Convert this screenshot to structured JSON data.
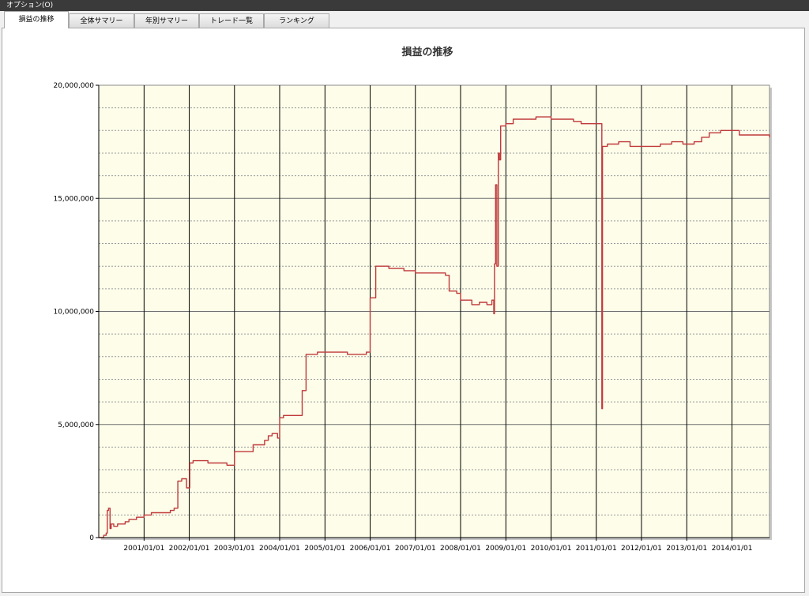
{
  "menubar": {
    "options_label": "オプション(O)"
  },
  "tabs": [
    {
      "label": "損益の推移",
      "active": true
    },
    {
      "label": "全体サマリー",
      "active": false
    },
    {
      "label": "年別サマリー",
      "active": false
    },
    {
      "label": "トレード一覧",
      "active": false
    },
    {
      "label": "ランキング",
      "active": false
    }
  ],
  "colors": {
    "plot_background": "#fdfde9",
    "series_line": "#c0393b",
    "grid_major": "#000000",
    "grid_minor": "#9a9a9a"
  },
  "chart_data": {
    "type": "line",
    "title": "損益の推移",
    "xlabel": "",
    "ylabel": "",
    "grid": true,
    "legend": "none",
    "xlim": [
      "2000-01-01",
      "2014-10-31"
    ],
    "ylim": [
      0,
      20000000
    ],
    "yticks": [
      0,
      5000000,
      10000000,
      15000000,
      20000000
    ],
    "ytick_labels": [
      "0",
      "5,000,000",
      "10,000,000",
      "15,000,000",
      "20,000,000"
    ],
    "xtick_labels": [
      "2001/01/01",
      "2002/01/01",
      "2003/01/01",
      "2004/01/01",
      "2005/01/01",
      "2006/01/01",
      "2007/01/01",
      "2008/01/01",
      "2009/01/01",
      "2010/01/01",
      "2011/01/01",
      "2012/01/01",
      "2013/01/01",
      "2014/01/01"
    ],
    "series": [
      {
        "points": [
          [
            "2000-01-01",
            0
          ],
          [
            "2000-02-10",
            100000
          ],
          [
            "2000-03-01",
            200000
          ],
          [
            "2000-03-10",
            1200000
          ],
          [
            "2000-03-20",
            1300000
          ],
          [
            "2000-04-01",
            400000
          ],
          [
            "2000-04-10",
            600000
          ],
          [
            "2000-05-01",
            500000
          ],
          [
            "2000-06-01",
            600000
          ],
          [
            "2000-07-01",
            600000
          ],
          [
            "2000-08-01",
            700000
          ],
          [
            "2000-09-01",
            800000
          ],
          [
            "2000-11-01",
            900000
          ],
          [
            "2001-01-01",
            1000000
          ],
          [
            "2001-03-01",
            1100000
          ],
          [
            "2001-06-01",
            1100000
          ],
          [
            "2001-08-01",
            1200000
          ],
          [
            "2001-09-01",
            1300000
          ],
          [
            "2001-10-01",
            2500000
          ],
          [
            "2001-11-01",
            2600000
          ],
          [
            "2001-12-10",
            2200000
          ],
          [
            "2002-01-05",
            3300000
          ],
          [
            "2002-02-01",
            3400000
          ],
          [
            "2002-06-01",
            3300000
          ],
          [
            "2002-10-01",
            3300000
          ],
          [
            "2002-11-01",
            3200000
          ],
          [
            "2003-01-01",
            3800000
          ],
          [
            "2003-03-01",
            3800000
          ],
          [
            "2003-06-01",
            4100000
          ],
          [
            "2003-09-01",
            4300000
          ],
          [
            "2003-10-01",
            4500000
          ],
          [
            "2003-11-01",
            4600000
          ],
          [
            "2003-12-15",
            4400000
          ],
          [
            "2004-01-01",
            5300000
          ],
          [
            "2004-02-01",
            5400000
          ],
          [
            "2004-06-01",
            5400000
          ],
          [
            "2004-07-01",
            6500000
          ],
          [
            "2004-08-01",
            8100000
          ],
          [
            "2004-11-01",
            8200000
          ],
          [
            "2005-06-01",
            8200000
          ],
          [
            "2005-07-01",
            8100000
          ],
          [
            "2005-12-01",
            8200000
          ],
          [
            "2006-01-01",
            10600000
          ],
          [
            "2006-02-15",
            12000000
          ],
          [
            "2006-06-01",
            11900000
          ],
          [
            "2006-10-01",
            11800000
          ],
          [
            "2007-01-01",
            11700000
          ],
          [
            "2007-06-01",
            11700000
          ],
          [
            "2007-09-01",
            11600000
          ],
          [
            "2007-10-01",
            10900000
          ],
          [
            "2007-12-01",
            10800000
          ],
          [
            "2008-01-01",
            10500000
          ],
          [
            "2008-04-01",
            10300000
          ],
          [
            "2008-06-01",
            10400000
          ],
          [
            "2008-08-01",
            10300000
          ],
          [
            "2008-09-10",
            10500000
          ],
          [
            "2008-09-25",
            9900000
          ],
          [
            "2008-10-01",
            12100000
          ],
          [
            "2008-10-10",
            15600000
          ],
          [
            "2008-10-20",
            12000000
          ],
          [
            "2008-11-01",
            17000000
          ],
          [
            "2008-11-10",
            16700000
          ],
          [
            "2008-11-20",
            18200000
          ],
          [
            "2009-01-01",
            18300000
          ],
          [
            "2009-03-01",
            18500000
          ],
          [
            "2009-06-01",
            18500000
          ],
          [
            "2009-09-01",
            18600000
          ],
          [
            "2009-12-01",
            18600000
          ],
          [
            "2010-01-01",
            18500000
          ],
          [
            "2010-06-01",
            18500000
          ],
          [
            "2010-07-01",
            18400000
          ],
          [
            "2010-09-01",
            18300000
          ],
          [
            "2011-01-01",
            18300000
          ],
          [
            "2011-02-10",
            18300000
          ],
          [
            "2011-02-15",
            5700000
          ],
          [
            "2011-02-20",
            17300000
          ],
          [
            "2011-04-01",
            17400000
          ],
          [
            "2011-07-01",
            17500000
          ],
          [
            "2011-10-01",
            17300000
          ],
          [
            "2012-03-01",
            17300000
          ],
          [
            "2012-06-01",
            17400000
          ],
          [
            "2012-09-01",
            17500000
          ],
          [
            "2012-12-01",
            17400000
          ],
          [
            "2013-03-01",
            17500000
          ],
          [
            "2013-05-01",
            17700000
          ],
          [
            "2013-07-01",
            17900000
          ],
          [
            "2013-10-01",
            18000000
          ],
          [
            "2014-01-01",
            18000000
          ],
          [
            "2014-03-01",
            17800000
          ],
          [
            "2014-06-01",
            17800000
          ],
          [
            "2014-10-31",
            17700000
          ]
        ]
      }
    ]
  }
}
